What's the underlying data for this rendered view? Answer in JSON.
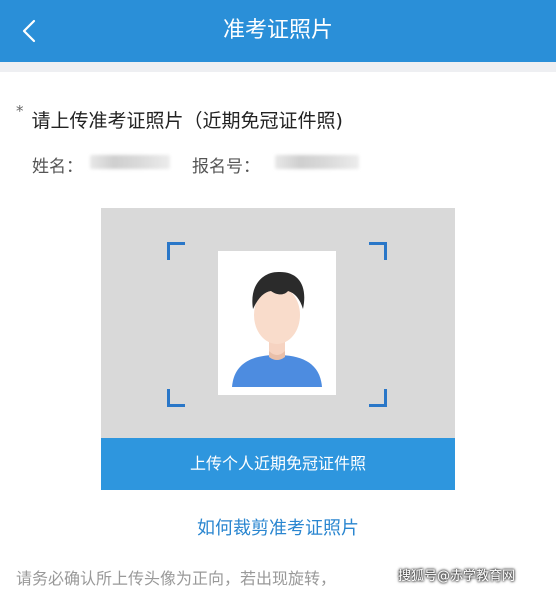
{
  "header": {
    "title": "准考证照片",
    "bg_color": "#2a8fd8"
  },
  "upload_section": {
    "required_mark": "*",
    "heading": "请上传准考证照片（近期免冠证件照)",
    "name_label": "姓名：",
    "reg_no_label": "报名号：",
    "upload_button": "上传个人近期免冠证件照",
    "help_link": "如何裁剪准考证照片"
  },
  "notice": "请务必确认所上传头像为正向，若出现旋转，",
  "watermark": "搜狐号@赤学教育网",
  "colors": {
    "accent": "#2e96de",
    "link": "#2a86d0",
    "frame_corner": "#2a77c8",
    "avatar_shirt": "#4d8ce0"
  }
}
